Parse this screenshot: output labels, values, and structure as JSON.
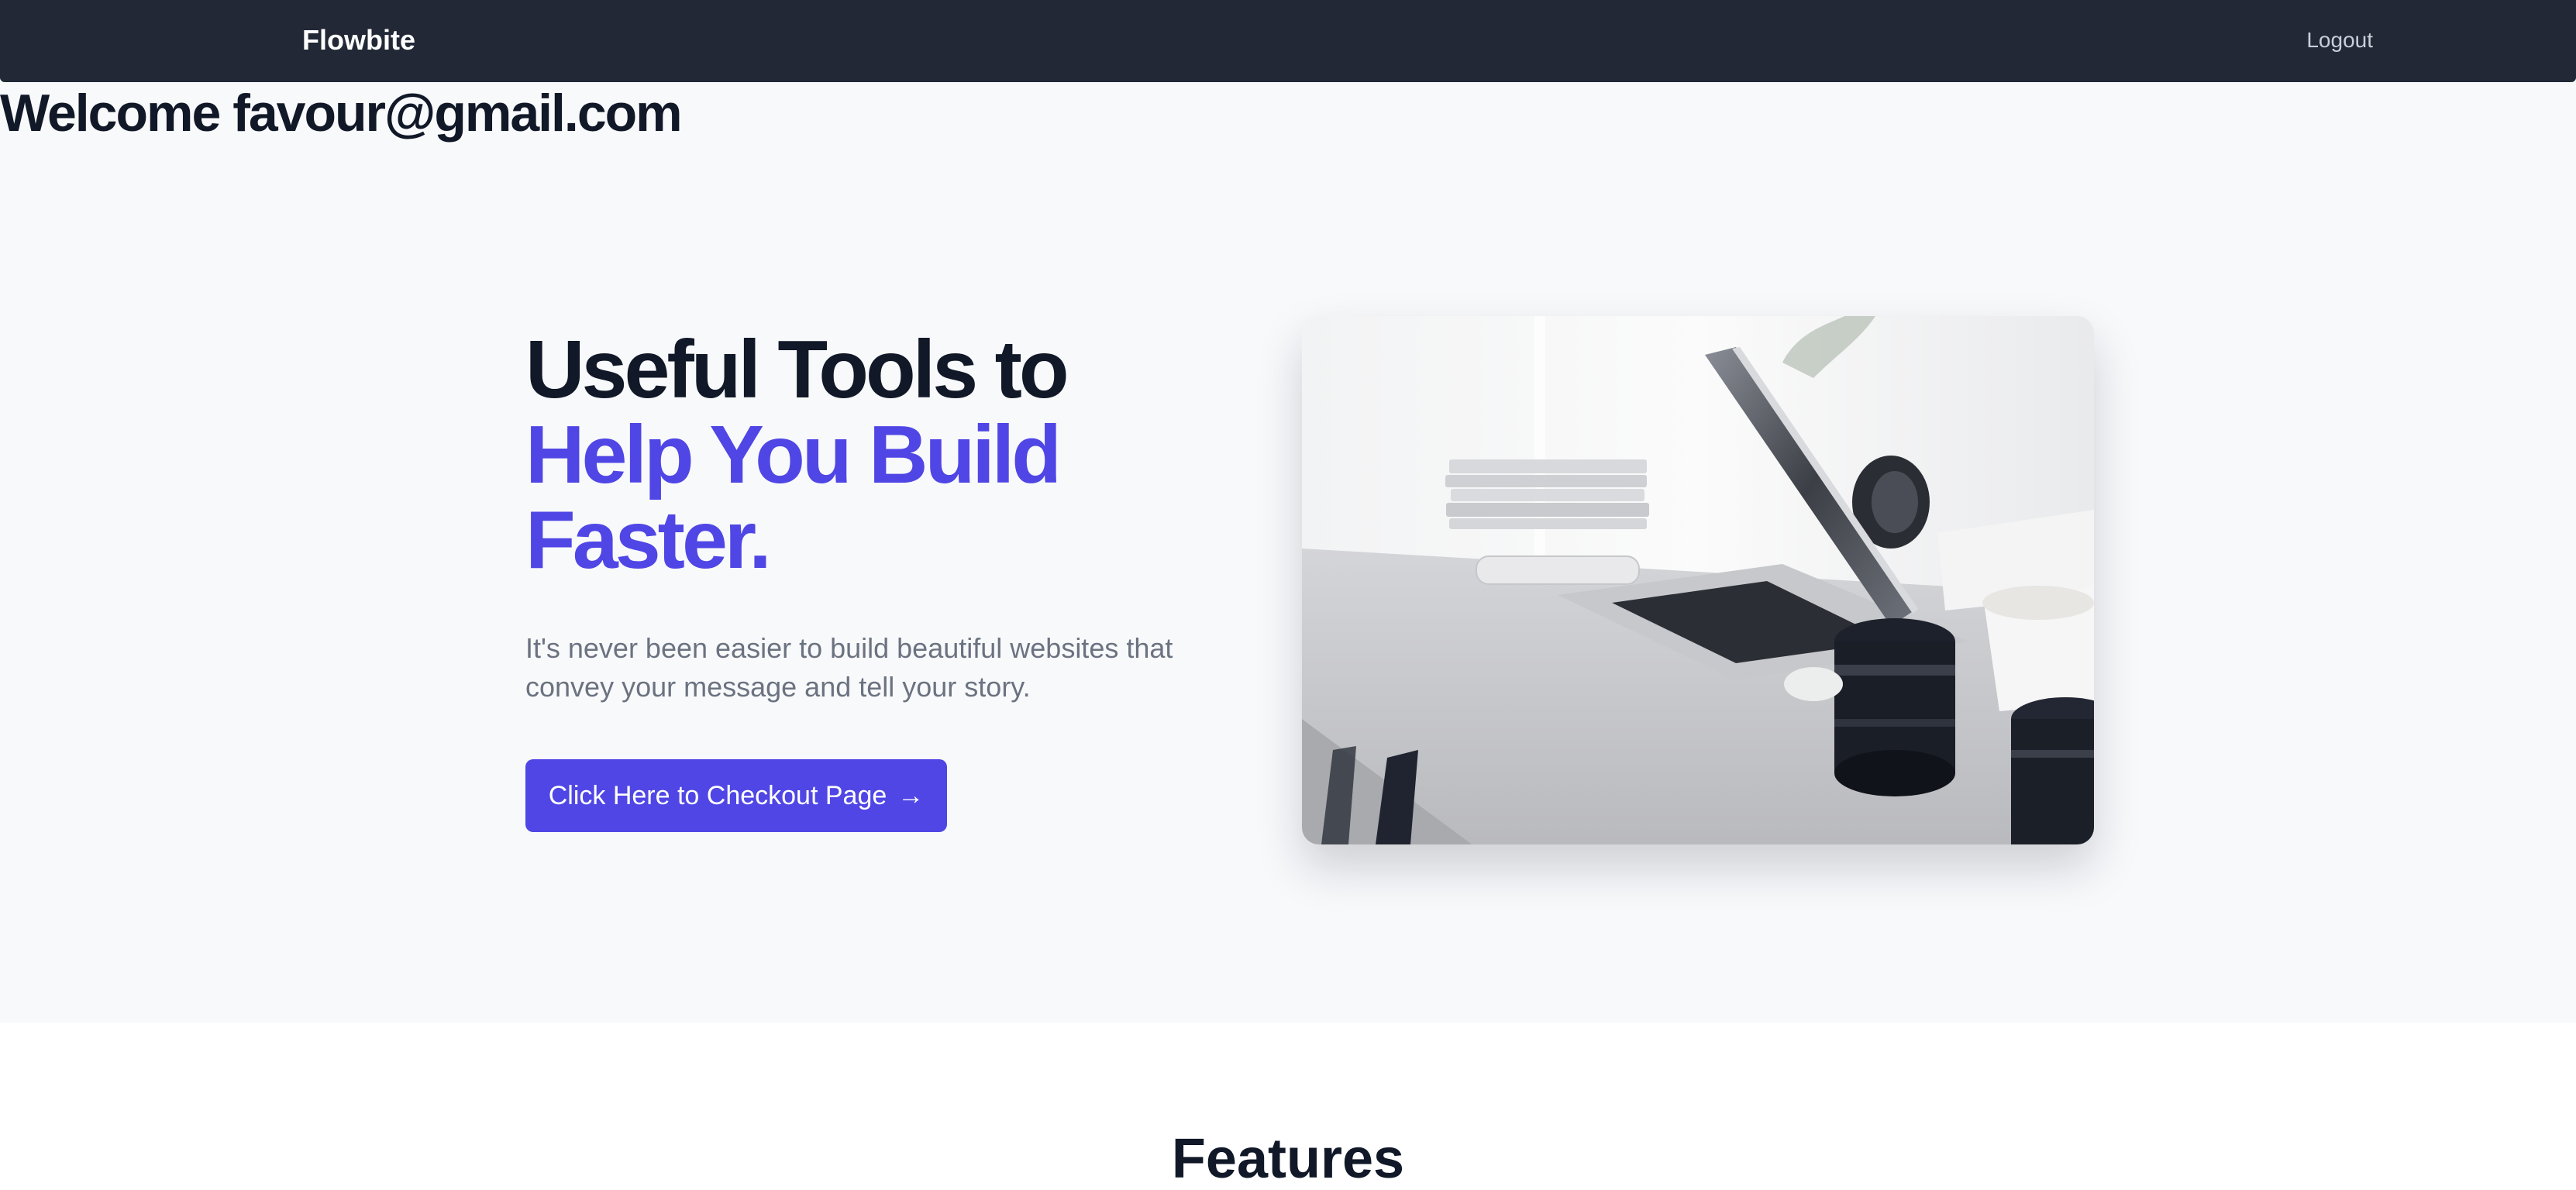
{
  "navbar": {
    "brand": "Flowbite",
    "logout_label": "Logout"
  },
  "welcome": {
    "text": "Welcome favour@gmail.com"
  },
  "hero": {
    "headline_line1": "Useful Tools to",
    "headline_accent_line1": "Help You Build",
    "headline_accent_line2": "Faster.",
    "description": "It's never been easier to build beautiful websites that convey your message and tell your story.",
    "cta_label": "Click Here to Checkout Page",
    "cta_icon": "arrow-right-icon",
    "image": "desk-with-laptop-photo"
  },
  "features": {
    "title": "Features"
  },
  "colors": {
    "navbar_bg": "#222836",
    "accent": "#4f46e5",
    "headline": "#111827",
    "muted_text": "#6b7280",
    "hero_bg": "#f8f9fb"
  }
}
